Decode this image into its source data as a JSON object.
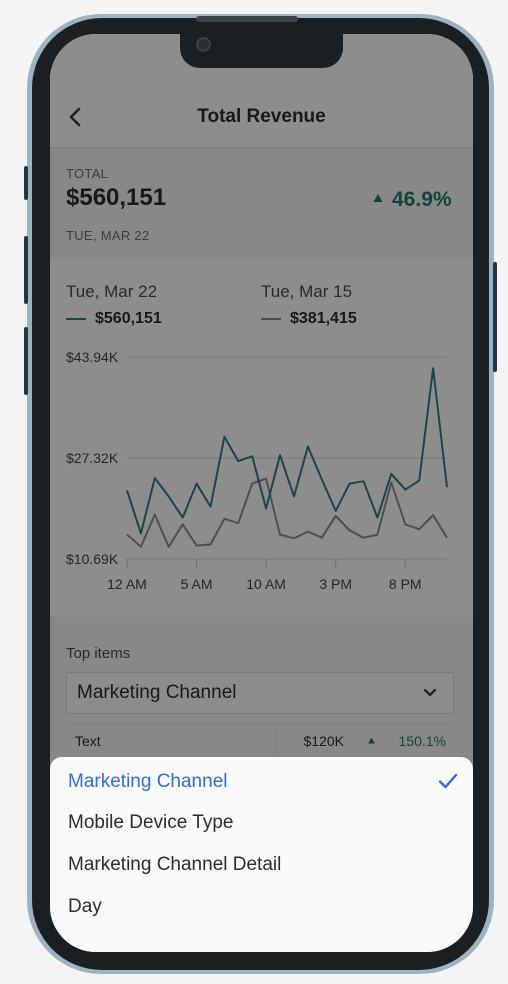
{
  "header": {
    "title": "Total Revenue",
    "back_icon": "chevron-left-icon"
  },
  "summary": {
    "label": "TOTAL",
    "value": "$560,151",
    "date": "TUE, MAR 22",
    "change": "46.9%",
    "change_icon": "triangle-up-icon",
    "change_color": "#1f7a66"
  },
  "legend": [
    {
      "date": "Tue, Mar 22",
      "value": "$560,151",
      "color": "#2f7e79"
    },
    {
      "date": "Tue, Mar 15",
      "value": "$381,415",
      "color": "#8b8b8b"
    }
  ],
  "chart_data": {
    "type": "line",
    "x": [
      "12 AM",
      "1 AM",
      "2 AM",
      "3 AM",
      "4 AM",
      "5 AM",
      "6 AM",
      "7 AM",
      "8 AM",
      "9 AM",
      "10 AM",
      "11 AM",
      "12 PM",
      "1 PM",
      "2 PM",
      "3 PM",
      "4 PM",
      "5 PM",
      "6 PM",
      "7 PM",
      "8 PM",
      "9 PM",
      "10 PM",
      "11 PM"
    ],
    "x_ticks": [
      "12 AM",
      "5 AM",
      "10 AM",
      "3 PM",
      "8 PM"
    ],
    "y_ticks": [
      "$43.94K",
      "$27.32K",
      "$10.69K"
    ],
    "ylim": [
      10.69,
      43.94
    ],
    "series": [
      {
        "name": "Tue, Mar 22",
        "color": "#2f7e79",
        "values": [
          22.0,
          14.9,
          24.0,
          21.0,
          17.5,
          23.1,
          19.3,
          30.8,
          26.8,
          27.6,
          19.0,
          27.8,
          21.0,
          29.2,
          23.8,
          18.6,
          23.1,
          23.5,
          17.5,
          24.7,
          22.1,
          23.6,
          42.1,
          22.5
        ]
      },
      {
        "name": "Tue, Mar 15",
        "color": "#8b8b8b",
        "values": [
          14.7,
          12.7,
          18.0,
          12.7,
          16.4,
          12.9,
          13.1,
          17.3,
          16.6,
          23.1,
          23.9,
          14.7,
          14.1,
          15.2,
          14.2,
          17.8,
          15.4,
          14.2,
          14.7,
          23.3,
          16.4,
          15.6,
          17.9,
          14.2
        ]
      }
    ],
    "grid": true,
    "legend_position": "top"
  },
  "top_items": {
    "label": "Top items",
    "select_value": "Marketing Channel",
    "select_icon": "chevron-down-icon",
    "row": {
      "text": "Text",
      "value": "$120K",
      "change": "150.1%"
    }
  },
  "sheet": {
    "options": [
      {
        "label": "Marketing Channel",
        "selected": true
      },
      {
        "label": "Mobile Device Type",
        "selected": false
      },
      {
        "label": "Marketing Channel Detail",
        "selected": false
      },
      {
        "label": "Day",
        "selected": false
      }
    ],
    "selected_icon": "checkmark-icon",
    "accent": "#2f6fcb"
  }
}
